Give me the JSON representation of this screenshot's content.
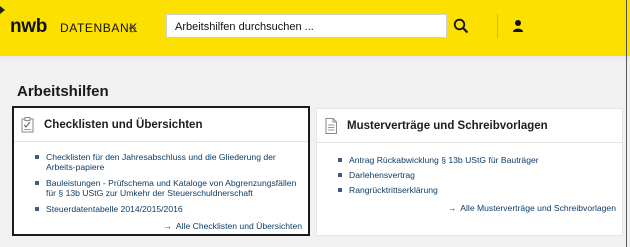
{
  "header": {
    "logo": "nwb",
    "logo_sub": "DATENBANK",
    "search_value": "Arbeitshilfen durchsuchen ...",
    "colors": {
      "accent": "#fbe000",
      "link": "#0e3d66"
    }
  },
  "page": {
    "title": "Arbeitshilfen"
  },
  "left_card": {
    "title": "Checklisten und Übersichten",
    "items": [
      {
        "label": "Checklisten für den Jahresabschluss und die Gliederung der Arbeits-papiere"
      },
      {
        "label": "Bauleistungen - Prüfschema und Kataloge von Abgrenzungsfällen für § 13b UStG zur Umkehr der Steuerschuldnerschaft"
      },
      {
        "label": "Steuerdatentabelle 2014/2015/2016"
      }
    ],
    "more": "Alle Checklisten und Übersichten"
  },
  "right_card": {
    "title": "Musterverträge und Schreibvorlagen",
    "items": [
      {
        "label": "Antrag Rückabwicklung § 13b UStG für Bauträger"
      },
      {
        "label": "Darlehensvertrag"
      },
      {
        "label": "Rangrücktrittserklärung"
      }
    ],
    "more": "Alle Musterverträge und Schreibvorlagen"
  },
  "icons": [
    "home-icon",
    "search-icon",
    "user-icon",
    "checklist-icon",
    "document-icon",
    "arrow-right-icon"
  ]
}
